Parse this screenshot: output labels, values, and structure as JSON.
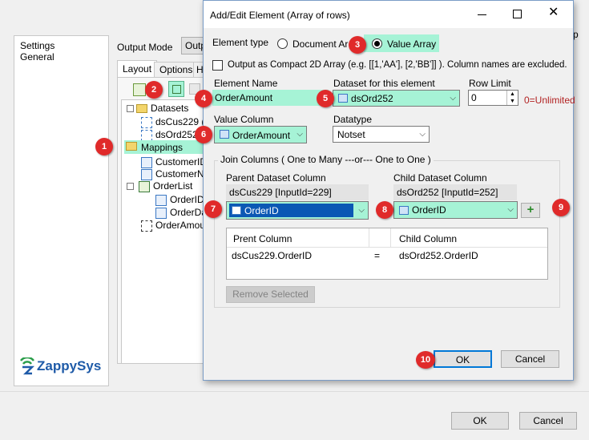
{
  "background": {
    "left_panel": [
      "Settings",
      "General"
    ],
    "output_mode_label": "Output Mode",
    "output_mode_value": "Outp",
    "tabs": [
      "Layout",
      "Options",
      "H"
    ],
    "tree": {
      "datasets": "Datasets",
      "ds1": "dsCus229 (",
      "ds2": "dsOrd252",
      "mappings": "Mappings",
      "m1": "CustomerID",
      "m2": "CustomerNa",
      "orderlist": "OrderList",
      "ol1": "OrderID",
      "ol2": "OrderDa",
      "orderamount": "OrderAmou"
    },
    "logo_text": "ZappySys",
    "ok": "OK",
    "cancel": "Cancel",
    "right_edge_char": "p"
  },
  "dialog": {
    "title": "Add/Edit Element (Array of rows)",
    "element_type_label": "Element type",
    "radio_document": "Document Arra",
    "radio_value": "Value Array",
    "compact_label": "Output as Compact 2D Array (e.g. [[1,'AA'], [2,'BB']] ). Column names are excluded.",
    "element_name_label": "Element Name",
    "element_name_value": "OrderAmount",
    "dataset_label": "Dataset for this element",
    "dataset_value": "dsOrd252",
    "row_limit_label": "Row Limit",
    "row_limit_value": "0",
    "unlimited_note": "0=Unlimited",
    "value_column_label": "Value Column",
    "value_column_value": "OrderAmount",
    "datatype_label": "Datatype",
    "datatype_value": "Notset",
    "join_label": "Join Columns  ( One to Many  ---or---  One to One )",
    "parent_col_label": "Parent Dataset Column",
    "parent_ds_text": "dsCus229 [InputId=229]",
    "parent_combo": "OrderID",
    "child_col_label": "Child Dataset Column",
    "child_ds_text": "dsOrd252 [InputId=252]",
    "child_combo": "OrderID",
    "grid_headers": [
      "Prent Column",
      "",
      "Child Column"
    ],
    "grid_row": [
      "dsCus229.OrderID",
      "=",
      "dsOrd252.OrderID"
    ],
    "remove_btn": "Remove Selected",
    "ok": "OK",
    "cancel": "Cancel"
  },
  "badges": [
    "1",
    "2",
    "3",
    "4",
    "5",
    "6",
    "7",
    "8",
    "9",
    "10"
  ],
  "colors": {
    "highlight": "#a6f3d6",
    "badge": "#e02a2a",
    "selection": "#0b58b4",
    "unlimited": "#b22222"
  }
}
